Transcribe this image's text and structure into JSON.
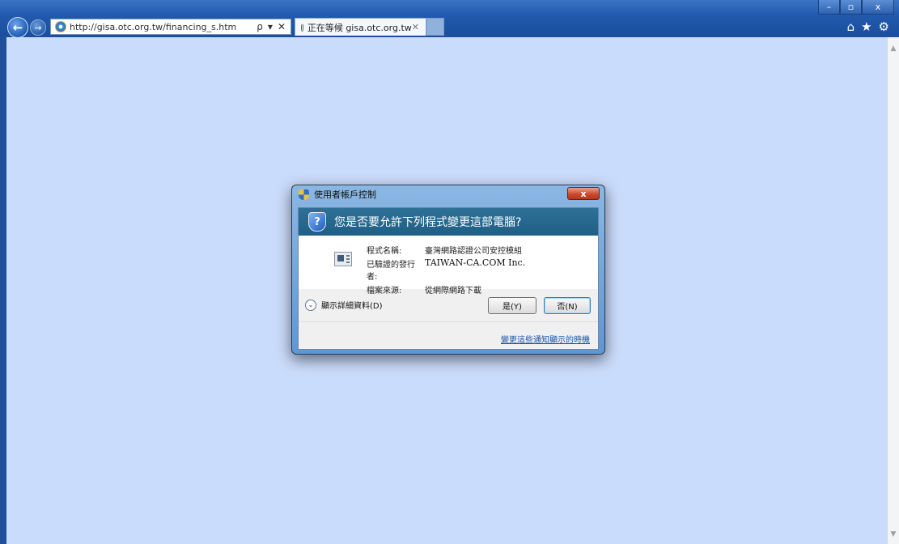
{
  "browser": {
    "url": "http://gisa.otc.org.tw/financing_s.htm",
    "search_glyph": "ρ",
    "dropdown_glyph": "▾",
    "stop_glyph": "✕",
    "tab_title": "正在等候 gisa.otc.org.tw",
    "tab_close_glyph": "✕",
    "back_glyph": "←",
    "forward_glyph": "→",
    "window_controls": {
      "minimize": "–",
      "maximize": "▫",
      "close": "x"
    },
    "tool_icons": {
      "home": "⌂",
      "favorites": "★",
      "tools": "⚙"
    }
  },
  "scrollbar": {
    "up_glyph": "▲",
    "down_glyph": "▼"
  },
  "dialog": {
    "title": "使用者帳戶控制",
    "close_glyph": "x",
    "question": "您是否要允許下列程式變更這部電腦?",
    "question_mark": "?",
    "program_name_label": "程式名稱:",
    "program_name": "臺灣網路認證公司安控模組",
    "publisher_label": "已驗證的發行者:",
    "publisher": "TAIWAN-CA.COM Inc.",
    "origin_label": "檔案來源:",
    "origin": "從網際網路下載",
    "details_label": "顯示詳細資料(D)",
    "details_glyph": "⌄",
    "yes_label": "是(Y)",
    "no_label": "否(N)",
    "change_link": "變更這些通知顯示的時機"
  },
  "icons": {
    "back": "back-arrow-icon",
    "forward": "forward-arrow-icon",
    "ie": "internet-explorer-icon",
    "uac_shield": "uac-shield-icon",
    "program": "program-icon"
  }
}
